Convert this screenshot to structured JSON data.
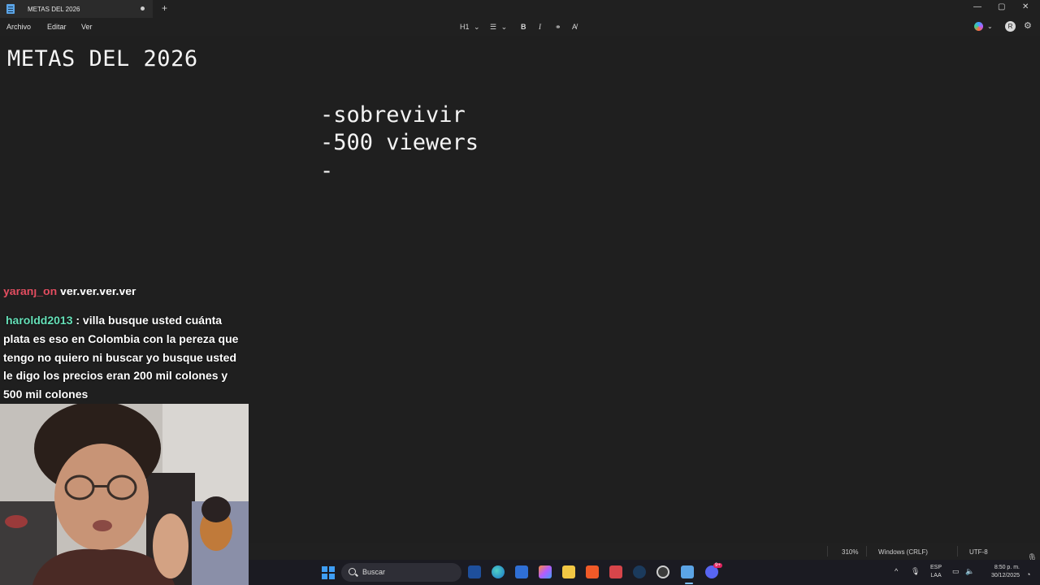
{
  "window": {
    "tab_title": "METAS DEL 2026",
    "new_tab_label": "+",
    "controls": {
      "minimize": "—",
      "maximize": "▢",
      "close": "✕"
    }
  },
  "menu": {
    "items": [
      "Archivo",
      "Editar",
      "Ver"
    ]
  },
  "format_toolbar": {
    "heading_label": "H1",
    "dropdown_glyph": "⌄",
    "list_glyph": "☰",
    "bold_glyph": "B",
    "italic_glyph": "I",
    "link_glyph": "⚭",
    "clear_glyph": "A̸"
  },
  "profile_initial": "R",
  "editor": {
    "title": "METAS DEL 2026",
    "lines": [
      "-sobrevivir",
      "-500 viewers",
      "-"
    ]
  },
  "chat": {
    "previous": {
      "user": "yarahj_on",
      "message": "ver.ver.ver.ver"
    },
    "message": {
      "user": "haroldd2013",
      "text": ": villa busque usted cuánta plata es eso en Colombia con la pereza que tengo no quiero ni buscar yo busque usted le digo los precios eran 200 mil colones y 500 mil colones"
    }
  },
  "status": {
    "zoom": "310%",
    "line_ending": "Windows (CRLF)",
    "encoding": "UTF-8"
  },
  "taskbar": {
    "search_label": "Buscar",
    "lang_line1": "ESP",
    "lang_line2": "LAA",
    "time": "8:50 p. m.",
    "date": "30/12/2025",
    "notification_count": "9+"
  },
  "icons": {
    "accent": "#3f9ef5",
    "names": [
      "notepad-icon",
      "search-icon",
      "windows-start-icon",
      "edge-icon",
      "store-icon",
      "copilot-icon",
      "file-explorer-icon",
      "brave-icon",
      "game-launcher-icon",
      "steam-icon",
      "obs-icon",
      "notepad-taskbar-icon",
      "discord-icon"
    ]
  }
}
